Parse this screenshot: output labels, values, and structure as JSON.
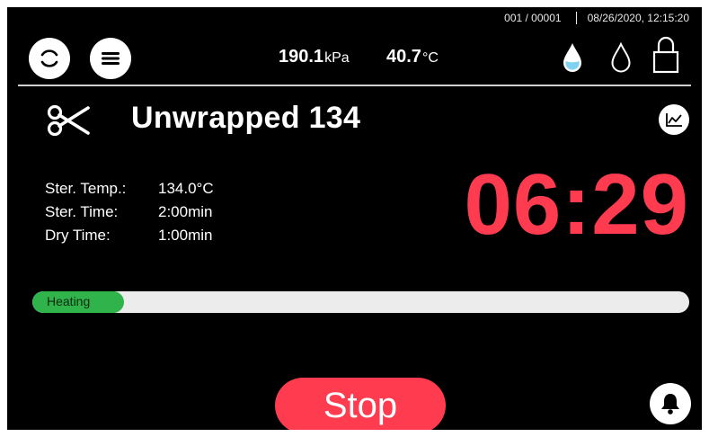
{
  "status": {
    "counter": "001 / 00001",
    "datetime": "08/26/2020, 12:15:20"
  },
  "readouts": {
    "pressure_value": "190.1",
    "pressure_unit": "kPa",
    "temperature_value": "40.7",
    "temperature_unit": "°C"
  },
  "program": {
    "name": "Unwrapped 134"
  },
  "params": [
    {
      "label": "Ster. Temp.:",
      "value": "134.0°C"
    },
    {
      "label": "Ster. Time:",
      "value": "2:00min"
    },
    {
      "label": "Dry Time:",
      "value": "1:00min"
    }
  ],
  "timer": "06:29",
  "progress": {
    "label": "Heating",
    "fraction": 0.14,
    "color": "#2fb34a"
  },
  "actions": {
    "stop_label": "Stop"
  },
  "colors": {
    "accent": "#ff3b4f",
    "background": "#000000",
    "progress_track": "#ececec"
  },
  "icons": {
    "refresh": "refresh-icon",
    "menu": "menu-icon",
    "water_full": "water-drop-filled-icon",
    "water_empty": "water-drop-empty-icon",
    "lock": "lock-icon",
    "scissors": "scissors-icon",
    "chart": "chart-icon",
    "bell": "bell-icon"
  }
}
